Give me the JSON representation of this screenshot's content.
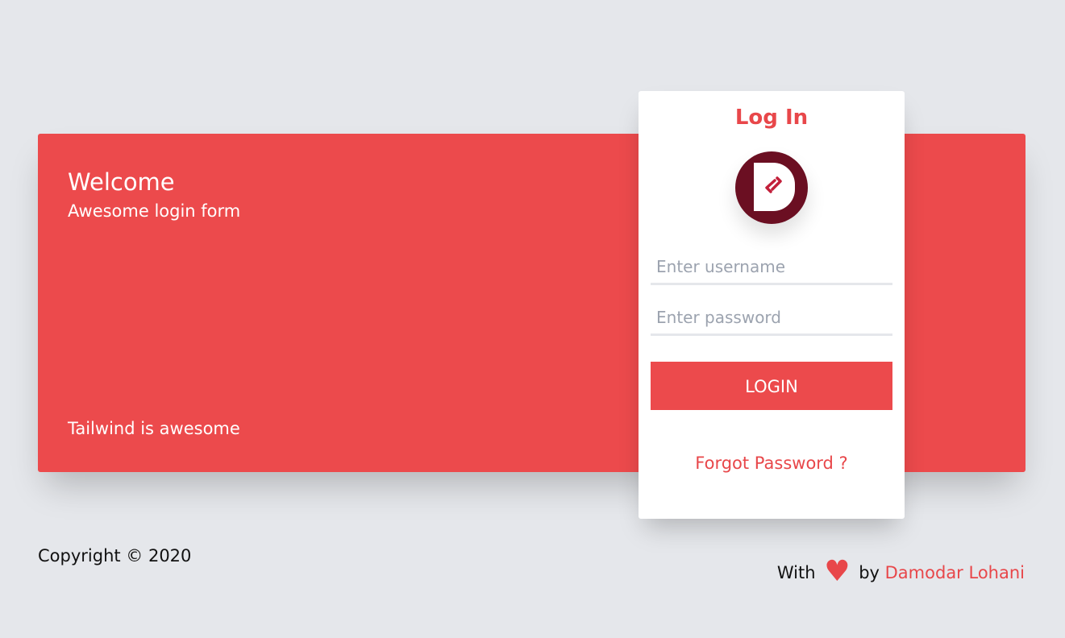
{
  "colors": {
    "background": "#e5e7eb",
    "accent": "#ec4a4c",
    "logo_bg": "#6b0f22",
    "card": "#ffffff"
  },
  "hero": {
    "title": "Welcome",
    "subtitle": "Awesome login form",
    "footer": "Tailwind is awesome"
  },
  "login_card": {
    "title": "Log In",
    "logo_icon": "d-logo-icon",
    "username_placeholder": "Enter username",
    "password_placeholder": "Enter password",
    "login_label": "LOGIN",
    "forgot_label": "Forgot Password ?"
  },
  "footer": {
    "copyright": "Copyright © 2020",
    "with": "With",
    "heart_icon": "heart-icon",
    "heart": "♥",
    "by": "by",
    "author": "Damodar Lohani"
  }
}
